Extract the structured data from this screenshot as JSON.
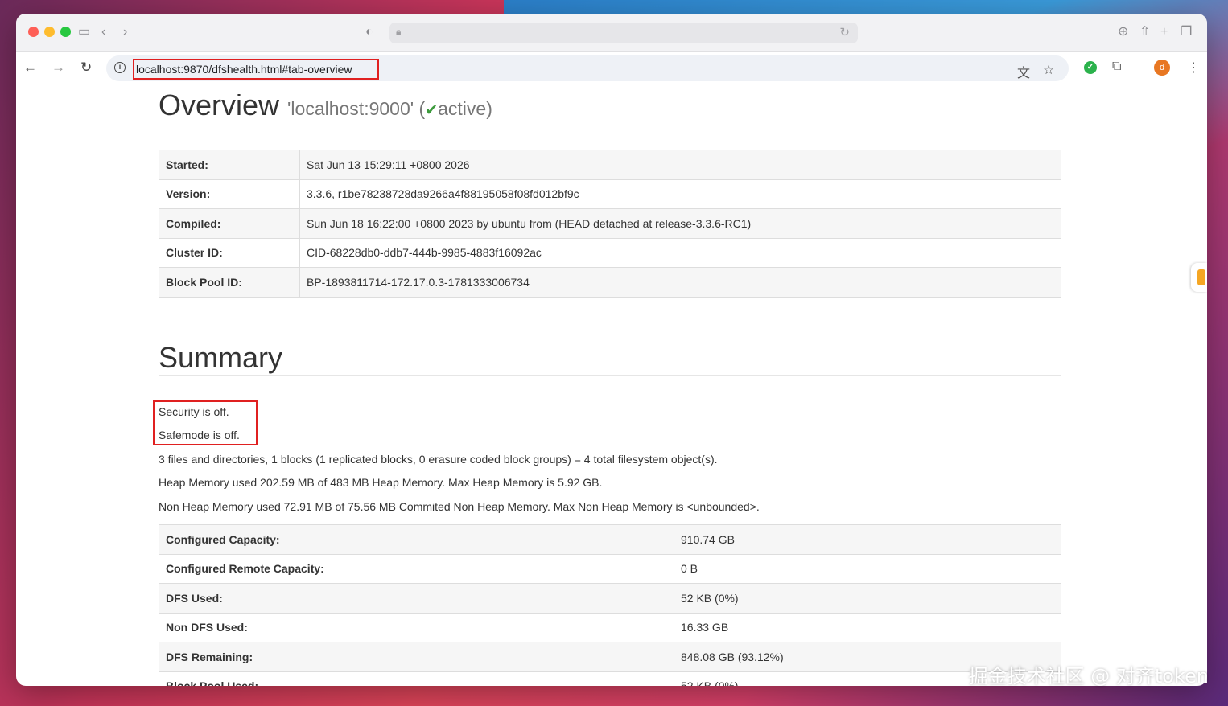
{
  "browser": {
    "url": "localhost:9870/dfshealth.html#tab-overview",
    "avatar_letter": "d"
  },
  "overview": {
    "title": "Overview",
    "subtitle_prefix": "'localhost:9000' (",
    "check": "✔",
    "subtitle_status": "active)",
    "rows": [
      {
        "label": "Started:",
        "value": "Sat Jun 13 15:29:11 +0800 2026"
      },
      {
        "label": "Version:",
        "value": "3.3.6, r1be78238728da9266a4f88195058f08fd012bf9c"
      },
      {
        "label": "Compiled:",
        "value": "Sun Jun 18 16:22:00 +0800 2023 by ubuntu from (HEAD detached at release-3.3.6-RC1)"
      },
      {
        "label": "Cluster ID:",
        "value": "CID-68228db0-ddb7-444b-9985-4883f16092ac"
      },
      {
        "label": "Block Pool ID:",
        "value": "BP-1893811714-172.17.0.3-1781333006734"
      }
    ]
  },
  "summary": {
    "title": "Summary",
    "security": "Security is off.",
    "safemode": "Safemode is off.",
    "files": "3 files and directories, 1 blocks (1 replicated blocks, 0 erasure coded block groups) = 4 total filesystem object(s).",
    "heap": "Heap Memory used 202.59 MB of 483 MB Heap Memory. Max Heap Memory is 5.92 GB.",
    "nonheap": "Non Heap Memory used 72.91 MB of 75.56 MB Commited Non Heap Memory. Max Non Heap Memory is <unbounded>.",
    "rows": [
      {
        "label": "Configured Capacity:",
        "value": "910.74 GB"
      },
      {
        "label": "Configured Remote Capacity:",
        "value": "0 B"
      },
      {
        "label": "DFS Used:",
        "value": "52 KB (0%)"
      },
      {
        "label": "Non DFS Used:",
        "value": "16.33 GB"
      },
      {
        "label": "DFS Remaining:",
        "value": "848.08 GB (93.12%)"
      },
      {
        "label": "Block Pool Used:",
        "value": "52 KB (0%)"
      }
    ]
  },
  "watermark": "掘金技术社区 @ 对齐token"
}
